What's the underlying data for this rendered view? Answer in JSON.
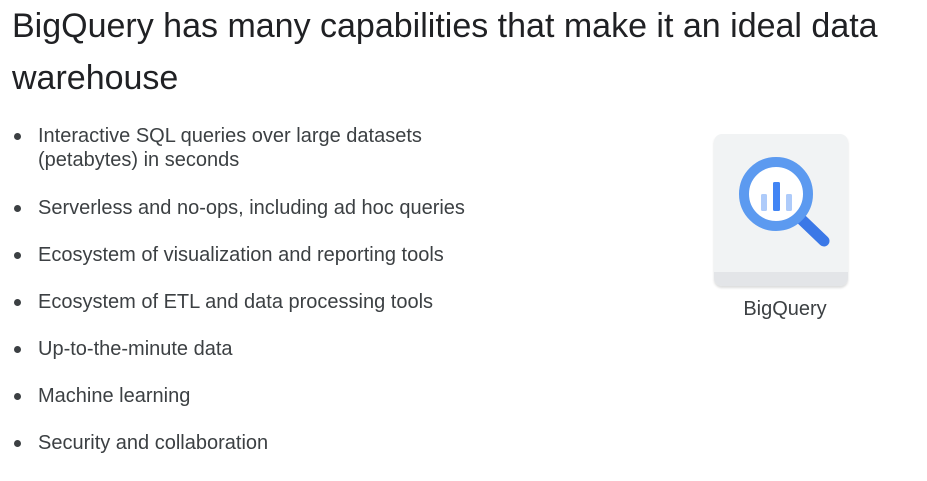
{
  "slide": {
    "title": "BigQuery has many capabilities that make it an ideal data warehouse",
    "bullets": [
      "Interactive SQL queries over large datasets (petabytes) in seconds",
      "Serverless and no-ops, including ad hoc queries",
      "Ecosystem of visualization and reporting tools",
      "Ecosystem of ETL and data processing tools",
      "Up-to-the-minute data",
      "Machine learning",
      "Security and collaboration"
    ]
  },
  "product": {
    "name": "BigQuery",
    "icon": "bigquery-magnifier-icon",
    "colors": {
      "ring": "#5c9af0",
      "ring_dark": "#3b78e7",
      "bars": "#aecbfa",
      "card": "#f1f3f4"
    }
  }
}
